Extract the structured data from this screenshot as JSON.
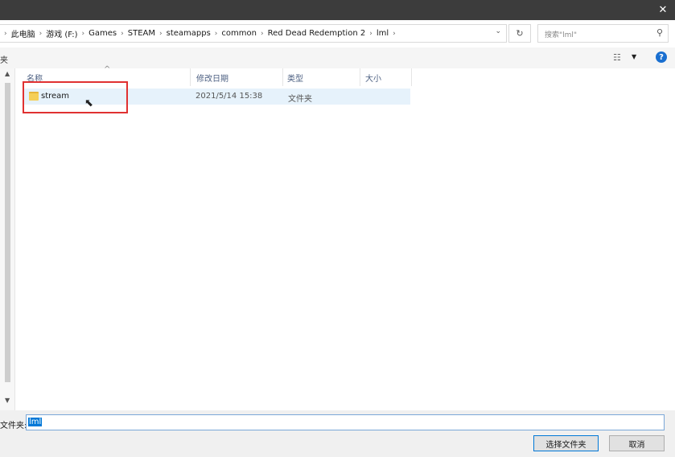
{
  "window": {
    "close_glyph": "✕"
  },
  "address": {
    "crumbs": [
      "此电脑",
      "游戏 (F:)",
      "Games",
      "STEAM",
      "steamapps",
      "common",
      "Red Dead Redemption 2",
      "lml"
    ],
    "separator": "›"
  },
  "search": {
    "placeholder": "搜索\"lml\""
  },
  "toolbar": {
    "left_label": "夹"
  },
  "columns": {
    "name": "名称",
    "date": "修改日期",
    "type": "类型",
    "size": "大小"
  },
  "files": [
    {
      "name": "stream",
      "modified": "2021/5/14 15:38",
      "type": "文件夹",
      "size": ""
    }
  ],
  "bottom": {
    "filename_label": "文件夹:",
    "filename_value": "lml",
    "select_button": "选择文件夹",
    "cancel_button": "取消"
  },
  "colors": {
    "accent": "#0078d7",
    "highlight_box": "#e03131",
    "title_bar": "#3c3c3c"
  }
}
